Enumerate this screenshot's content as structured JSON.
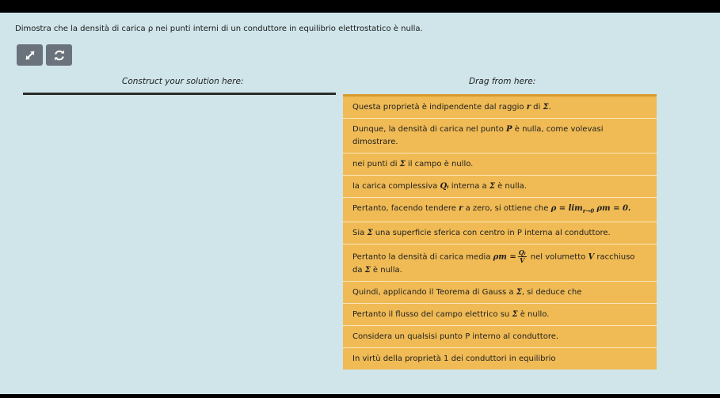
{
  "question": "Dimostra che la densità di carica ρ nei punti interni di un conduttore in equilibrio elettrostatico è nulla.",
  "toolbar": {
    "expand_icon": "expand-arrows-icon",
    "reset_icon": "refresh-icon"
  },
  "construct_label": "Construct your solution here:",
  "drag_label": "Drag from here:",
  "colors": {
    "background": "#cfe5e9",
    "button": "#6a737b",
    "item_bg": "#f0bb55",
    "item_top_border": "#d89a2c"
  },
  "items": [
    {
      "pre": "Questa proprietà è indipendente dal raggio ",
      "m1": "r",
      "mid": " di ",
      "m2": "Σ",
      "post": "."
    },
    {
      "pre": "Dunque, la densità di carica nel punto ",
      "m1": "P",
      "mid": " è nulla, come volevasi dimostrare.",
      "m2": "",
      "post": ""
    },
    {
      "pre": "nei punti di ",
      "m1": "Σ",
      "mid": " il campo è nullo.",
      "m2": "",
      "post": ""
    },
    {
      "pre": "la carica complessiva ",
      "m1": "Qᵢ",
      "mid": " interna a ",
      "m2": "Σ",
      "post": " è nulla."
    },
    {
      "pre": "Pertanto, facendo tendere ",
      "m1": "r",
      "mid": " a zero, si ottiene che ",
      "m2": "ρ = lim",
      "post": "ρm = 0."
    },
    {
      "pre": "Sia ",
      "m1": "Σ",
      "mid": " una superficie sferica con centro in P interna al conduttore.",
      "m2": "",
      "post": ""
    },
    {
      "pre": "Pertanto la densità di carica media ",
      "m1": "ρm =",
      "num": "Qᵢ",
      "den": "V",
      "mid": " nel volumetto ",
      "m2": "V",
      "post": " racchiuso da ",
      "m3": "Σ",
      "post2": " è nulla."
    },
    {
      "pre": "Quindi, applicando il Teorema di Gauss a ",
      "m1": "Σ",
      "mid": ", si deduce che",
      "m2": "",
      "post": ""
    },
    {
      "pre": "Pertanto il flusso del campo elettrico su ",
      "m1": "Σ",
      "mid": " è nullo.",
      "m2": "",
      "post": ""
    },
    {
      "pre": "Considera un qualsisi punto P interno al conduttore.",
      "m1": "",
      "mid": "",
      "m2": "",
      "post": ""
    },
    {
      "pre": "In virtù della proprietà 1 dei conduttori in equilibrio",
      "m1": "",
      "mid": "",
      "m2": "",
      "post": ""
    }
  ],
  "limit_sub": "r→0"
}
